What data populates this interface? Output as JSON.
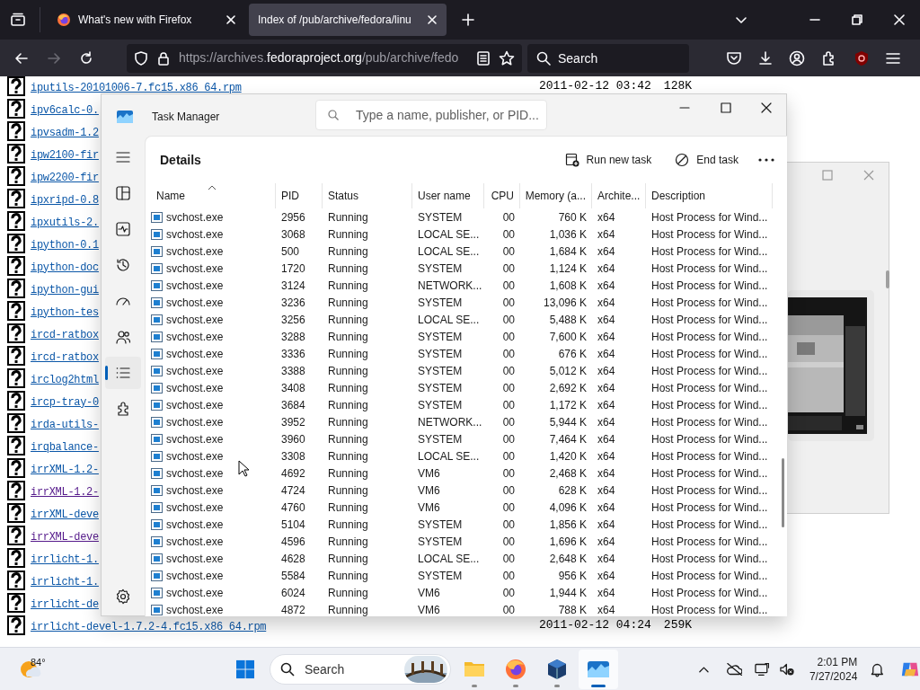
{
  "browser": {
    "tabs": [
      {
        "title": "What's new with Firefox",
        "selected": false
      },
      {
        "title": "Index of /pub/archive/fedora/linu",
        "selected": true
      }
    ],
    "url": [
      {
        "text": "https://archives.",
        "highlight": false
      },
      {
        "text": "fedoraproject.org",
        "highlight": true
      },
      {
        "text": "/pub/archive/fedo",
        "highlight": false
      }
    ],
    "search": {
      "placeholder": "Search"
    }
  },
  "listing": [
    {
      "name": "iputils-20101006-7.fc15.x86_64.rpm",
      "visited": false,
      "date": "2011-02-12 03:42",
      "size": "128K"
    },
    {
      "name": "ipv6calc-0.",
      "visited": false
    },
    {
      "name": "ipvsadm-1.2",
      "visited": false
    },
    {
      "name": "ipw2100-fir",
      "visited": false
    },
    {
      "name": "ipw2200-fir",
      "visited": false
    },
    {
      "name": "ipxripd-0.8",
      "visited": false
    },
    {
      "name": "ipxutils-2.",
      "visited": false
    },
    {
      "name": "ipython-0.1",
      "visited": false
    },
    {
      "name": "ipython-doc",
      "visited": false
    },
    {
      "name": "ipython-gui",
      "visited": false
    },
    {
      "name": "ipython-tes",
      "visited": false
    },
    {
      "name": "ircd-ratbox",
      "visited": false
    },
    {
      "name": "ircd-ratbox",
      "visited": false
    },
    {
      "name": "irclog2html",
      "visited": false
    },
    {
      "name": "ircp-tray-0",
      "visited": false
    },
    {
      "name": "irda-utils-",
      "visited": false
    },
    {
      "name": "irqbalance-",
      "visited": false
    },
    {
      "name": "irrXML-1.2-",
      "visited": false
    },
    {
      "name": "irrXML-1.2-",
      "visited": true
    },
    {
      "name": "irrXML-deve",
      "visited": false
    },
    {
      "name": "irrXML-deve",
      "visited": true
    },
    {
      "name": "irrlicht-1.",
      "visited": false
    },
    {
      "name": "irrlicht-1.",
      "visited": false
    },
    {
      "name": "irrlicht-de",
      "visited": false
    },
    {
      "name": "irrlicht-devel-1.7.2-4.fc15.x86_64.rpm",
      "visited": false,
      "date": "2011-02-12 04:24",
      "size": "259K"
    }
  ],
  "task_manager": {
    "title": "Task Manager",
    "search": {
      "placeholder": "Type a name, publisher, or PID..."
    },
    "nav": [
      {
        "kind": "menu",
        "selected": false
      },
      {
        "kind": "processes",
        "selected": false
      },
      {
        "kind": "performance",
        "selected": false
      },
      {
        "kind": "history",
        "selected": false
      },
      {
        "kind": "startup",
        "selected": false
      },
      {
        "kind": "users",
        "selected": false
      },
      {
        "kind": "details",
        "selected": true
      },
      {
        "kind": "services",
        "selected": false
      },
      {
        "kind": "settings",
        "selected": false
      }
    ],
    "page_title": "Details",
    "actions": [
      "Run new task",
      "End task"
    ],
    "columns": [
      "Name",
      "PID",
      "Status",
      "User name",
      "CPU",
      "Memory (a...",
      "Archite...",
      "Description"
    ],
    "rows": [
      [
        "svchost.exe",
        "2956",
        "Running",
        "SYSTEM",
        "00",
        "760 K",
        "x64",
        "Host Process for Wind..."
      ],
      [
        "svchost.exe",
        "3068",
        "Running",
        "LOCAL SE...",
        "00",
        "1,036 K",
        "x64",
        "Host Process for Wind..."
      ],
      [
        "svchost.exe",
        "500",
        "Running",
        "LOCAL SE...",
        "00",
        "1,684 K",
        "x64",
        "Host Process for Wind..."
      ],
      [
        "svchost.exe",
        "1720",
        "Running",
        "SYSTEM",
        "00",
        "1,124 K",
        "x64",
        "Host Process for Wind..."
      ],
      [
        "svchost.exe",
        "3124",
        "Running",
        "NETWORK...",
        "00",
        "1,608 K",
        "x64",
        "Host Process for Wind..."
      ],
      [
        "svchost.exe",
        "3236",
        "Running",
        "SYSTEM",
        "00",
        "13,096 K",
        "x64",
        "Host Process for Wind..."
      ],
      [
        "svchost.exe",
        "3256",
        "Running",
        "LOCAL SE...",
        "00",
        "5,488 K",
        "x64",
        "Host Process for Wind..."
      ],
      [
        "svchost.exe",
        "3288",
        "Running",
        "SYSTEM",
        "00",
        "7,600 K",
        "x64",
        "Host Process for Wind..."
      ],
      [
        "svchost.exe",
        "3336",
        "Running",
        "SYSTEM",
        "00",
        "676 K",
        "x64",
        "Host Process for Wind..."
      ],
      [
        "svchost.exe",
        "3388",
        "Running",
        "SYSTEM",
        "00",
        "5,012 K",
        "x64",
        "Host Process for Wind..."
      ],
      [
        "svchost.exe",
        "3408",
        "Running",
        "SYSTEM",
        "00",
        "2,692 K",
        "x64",
        "Host Process for Wind..."
      ],
      [
        "svchost.exe",
        "3684",
        "Running",
        "SYSTEM",
        "00",
        "1,172 K",
        "x64",
        "Host Process for Wind..."
      ],
      [
        "svchost.exe",
        "3952",
        "Running",
        "NETWORK...",
        "00",
        "5,944 K",
        "x64",
        "Host Process for Wind..."
      ],
      [
        "svchost.exe",
        "3960",
        "Running",
        "SYSTEM",
        "00",
        "7,464 K",
        "x64",
        "Host Process for Wind..."
      ],
      [
        "svchost.exe",
        "3308",
        "Running",
        "LOCAL SE...",
        "00",
        "1,420 K",
        "x64",
        "Host Process for Wind..."
      ],
      [
        "svchost.exe",
        "4692",
        "Running",
        "VM6",
        "00",
        "2,468 K",
        "x64",
        "Host Process for Wind..."
      ],
      [
        "svchost.exe",
        "4724",
        "Running",
        "VM6",
        "00",
        "628 K",
        "x64",
        "Host Process for Wind..."
      ],
      [
        "svchost.exe",
        "4760",
        "Running",
        "VM6",
        "00",
        "4,096 K",
        "x64",
        "Host Process for Wind..."
      ],
      [
        "svchost.exe",
        "5104",
        "Running",
        "SYSTEM",
        "00",
        "1,856 K",
        "x64",
        "Host Process for Wind..."
      ],
      [
        "svchost.exe",
        "4596",
        "Running",
        "SYSTEM",
        "00",
        "1,696 K",
        "x64",
        "Host Process for Wind..."
      ],
      [
        "svchost.exe",
        "4628",
        "Running",
        "LOCAL SE...",
        "00",
        "2,648 K",
        "x64",
        "Host Process for Wind..."
      ],
      [
        "svchost.exe",
        "5584",
        "Running",
        "SYSTEM",
        "00",
        "956 K",
        "x64",
        "Host Process for Wind..."
      ],
      [
        "svchost.exe",
        "6024",
        "Running",
        "VM6",
        "00",
        "1,944 K",
        "x64",
        "Host Process for Wind..."
      ],
      [
        "svchost.exe",
        "4872",
        "Running",
        "VM6",
        "00",
        "788 K",
        "x64",
        "Host Process for Wind..."
      ]
    ]
  },
  "taskbar": {
    "weather": "84°",
    "search": {
      "placeholder": "Search"
    },
    "apps": [
      {
        "kind": "folder",
        "active": false
      },
      {
        "kind": "firefox",
        "active": false
      },
      {
        "kind": "virtualbox",
        "active": false
      },
      {
        "kind": "taskmanager",
        "active": true
      }
    ],
    "time": "2:01 PM",
    "date": "7/27/2024"
  }
}
